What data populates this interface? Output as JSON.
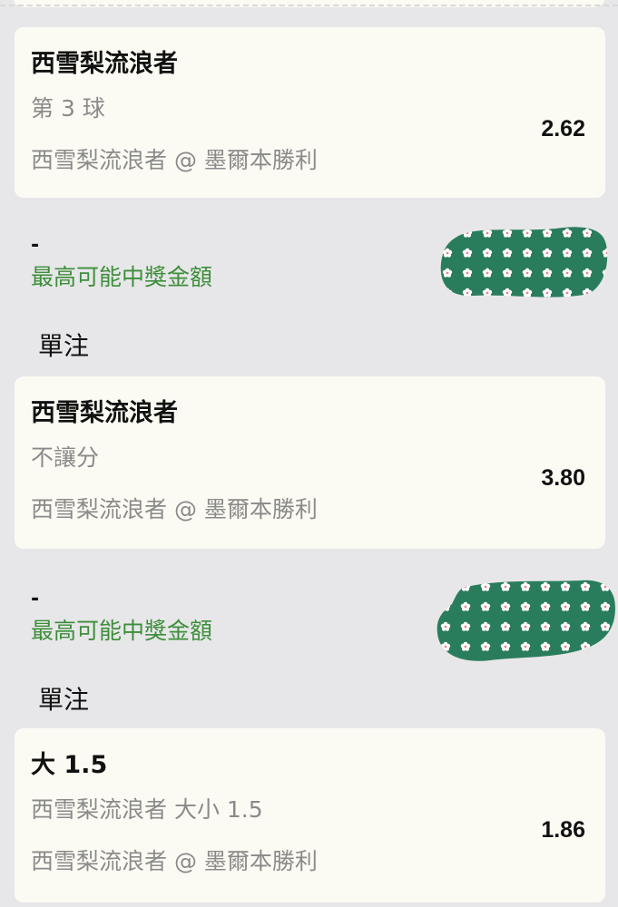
{
  "bets": [
    {
      "selection": "西雪梨流浪者",
      "market": "第 3 球",
      "event": "西雪梨流浪者 @ 墨爾本勝利",
      "odds": "2.62"
    },
    {
      "selection": "西雪梨流浪者",
      "market": "不讓分",
      "event": "西雪梨流浪者 @ 墨爾本勝利",
      "odds": "3.80"
    },
    {
      "selection": "大 1.5",
      "market": "西雪梨流浪者 大小 1.5",
      "event": "西雪梨流浪者 @ 墨爾本勝利",
      "odds": "1.86"
    }
  ],
  "stake_sections": [
    {
      "max_win_value": "-",
      "max_win_label": "最高可能中獎金額",
      "bet_type": "單注",
      "redaction_icon": "flower-pattern-redaction"
    },
    {
      "max_win_value": "-",
      "max_win_label": "最高可能中獎金額",
      "bet_type": "單注",
      "redaction_icon": "flower-pattern-redaction"
    }
  ],
  "colors": {
    "background": "#e7e7e9",
    "card": "#fcfbf3",
    "label_green": "#3e8e3a",
    "redaction_green": "#2a7d5c"
  }
}
